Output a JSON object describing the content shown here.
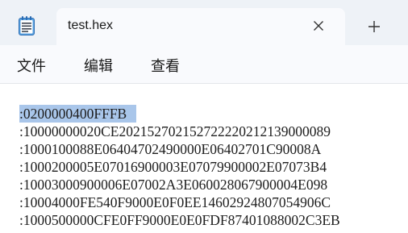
{
  "tab": {
    "icon": "notepad-icon",
    "title": "test.hex",
    "close_icon": "close-icon",
    "new_tab_icon": "plus-icon"
  },
  "menu": {
    "file": "文件",
    "edit": "编辑",
    "view": "查看"
  },
  "editor": {
    "selection_color": "#a9c6ea",
    "lines": [
      ":0200000400FFFB",
      ":10000000020CE202152702152722220212139000089",
      ":1000100088E06404702490000E06402701C90008A",
      ":1000200005E07016900003E07079900002E07073B4",
      ":10003000900006E07002A3E060028067900004E098",
      ":10004000FE540F9000E0F0EE14602924807054906C",
      ":1000500000CFE0FF9000E0E0FDF87401088002C3EB"
    ]
  }
}
